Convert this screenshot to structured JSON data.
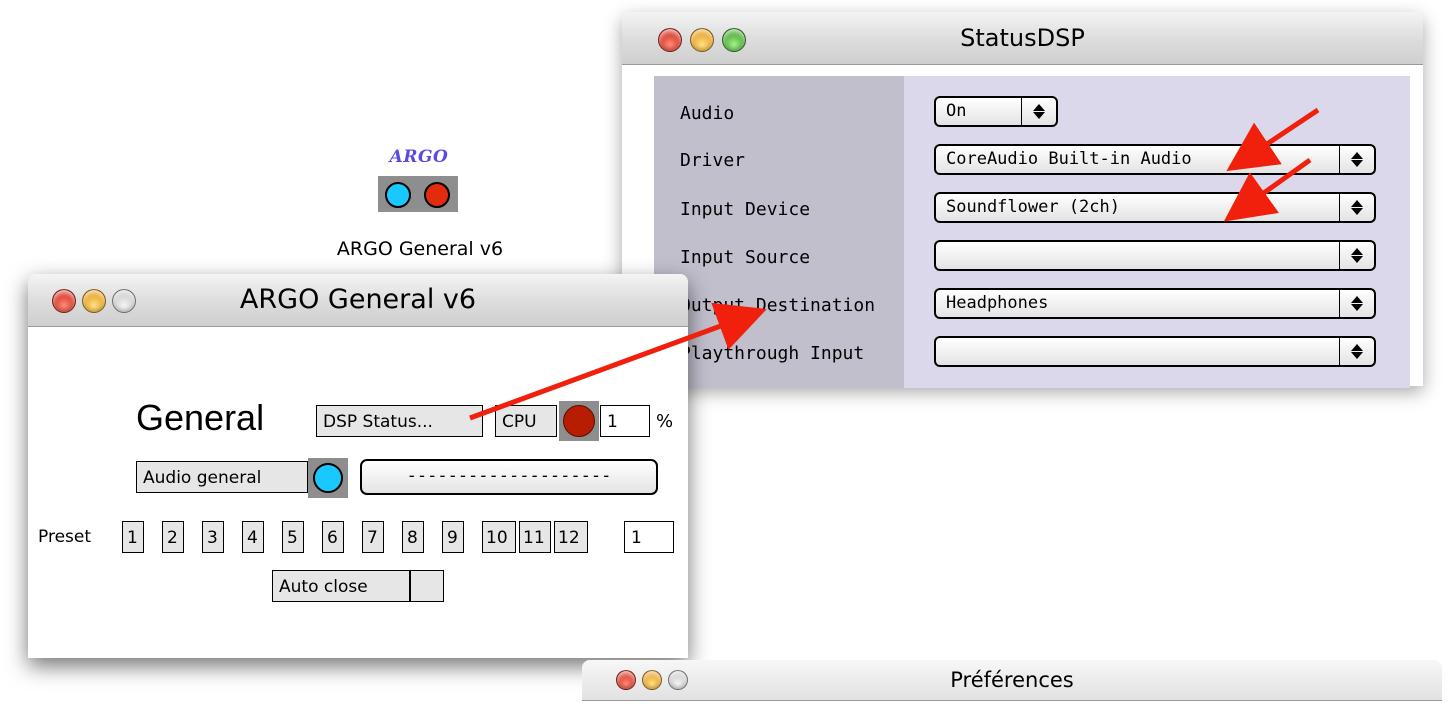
{
  "desktop_icon": {
    "logo_text": "ARGO",
    "caption": "ARGO General v6",
    "colors": {
      "left_dot": "#19c8ff",
      "right_dot": "#e32b0d",
      "logo": "#5a4ae0"
    }
  },
  "argo_window": {
    "title": "ARGO General v6",
    "heading": "General",
    "dsp_status_button": "DSP Status...",
    "cpu_label": "CPU",
    "cpu_value": "1",
    "cpu_unit": "%",
    "audio_general_button": "Audio general",
    "message_field": "--------------------",
    "preset_label": "Preset",
    "presets": [
      "1",
      "2",
      "3",
      "4",
      "5",
      "6",
      "7",
      "8",
      "9",
      "10",
      "11",
      "12"
    ],
    "preset_current": "1",
    "auto_close_label": "Auto close",
    "indicator_colors": {
      "cpu": "#b71d00",
      "audio": "#19c8ff"
    }
  },
  "dsp_window": {
    "title": "StatusDSP",
    "rows": [
      {
        "label": "Audio",
        "value": "On"
      },
      {
        "label": "Driver",
        "value": "CoreAudio Built-in Audio"
      },
      {
        "label": "Input Device",
        "value": "Soundflower (2ch)"
      },
      {
        "label": "Input Source",
        "value": ""
      },
      {
        "label": "Output Destination",
        "value": "Headphones"
      },
      {
        "label": "Playthrough Input",
        "value": ""
      }
    ],
    "colors": {
      "panel": "#dcd8ec",
      "label_column": "#c2bfcd",
      "annotation_arrow": "#f0200c"
    }
  },
  "preferences_window": {
    "title": "Préférences"
  }
}
